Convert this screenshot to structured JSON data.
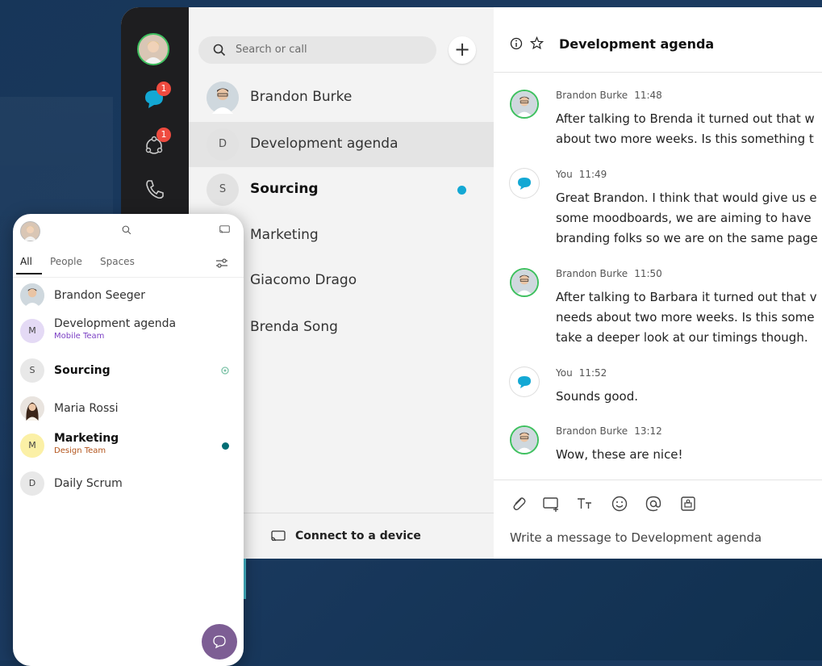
{
  "colors": {
    "background": "#173659",
    "online": "#3ec05f",
    "badge": "#ef4b3f",
    "unread": "#13a8d4",
    "phone_unread": "#006d74",
    "fab": "#7d5e94"
  },
  "rail": {
    "items": [
      {
        "icon": "avatar"
      },
      {
        "icon": "chat-bubble-icon",
        "badge": "1"
      },
      {
        "icon": "teams-icon",
        "badge": "1"
      },
      {
        "icon": "phone-icon"
      }
    ]
  },
  "spaces": {
    "search_placeholder": "Search or call",
    "add_label": "+",
    "items": [
      {
        "name": "Brandon Burke",
        "initial": ""
      },
      {
        "name": "Development agenda",
        "initial": "D"
      },
      {
        "name": "Sourcing",
        "initial": "S"
      },
      {
        "name": "Marketing",
        "initial": ""
      },
      {
        "name": "Giacomo Drago",
        "initial": ""
      },
      {
        "name": "Brenda Song",
        "initial": ""
      }
    ],
    "connect_label": "Connect to a device"
  },
  "chat": {
    "title": "Development agenda",
    "messages": [
      {
        "author": "Brandon Burke",
        "time": "11:48",
        "lines": [
          "After talking to Brenda it turned out that w",
          "about two more weeks. Is this something t"
        ]
      },
      {
        "author": "You",
        "time": "11:49",
        "lines": [
          "Great Brandon. I think that would give us e",
          "some moodboards, we are aiming to have",
          "branding folks so we are on the same page"
        ]
      },
      {
        "author": "Brandon Burke",
        "time": "11:50",
        "lines": [
          "After talking to Barbara it turned out that v",
          "needs about two more weeks. Is this some",
          "take a deeper look at our timings though."
        ]
      },
      {
        "author": "You",
        "time": "11:52",
        "lines": [
          "Sounds good."
        ]
      },
      {
        "author": "Brandon Burke",
        "time": "13:12",
        "lines": [
          "Wow, these are nice!"
        ]
      }
    ],
    "toolbar": [
      "attach-icon",
      "whiteboard-icon",
      "format-text-icon",
      "emoji-icon",
      "mention-icon",
      "share-icon"
    ],
    "compose_placeholder": "Write a message to Development agenda"
  },
  "mobile": {
    "tabs": [
      "All",
      "People",
      "Spaces"
    ],
    "items": [
      {
        "name": "Brandon Seeger",
        "initial": "",
        "sub": ""
      },
      {
        "name": "Development agenda",
        "initial": "M",
        "sub": "Mobile Team"
      },
      {
        "name": "Sourcing",
        "initial": "S",
        "sub": ""
      },
      {
        "name": "Maria Rossi",
        "initial": "",
        "sub": ""
      },
      {
        "name": "Marketing",
        "initial": "M",
        "sub": "Design Team"
      },
      {
        "name": "Daily Scrum",
        "initial": "D",
        "sub": ""
      }
    ]
  }
}
